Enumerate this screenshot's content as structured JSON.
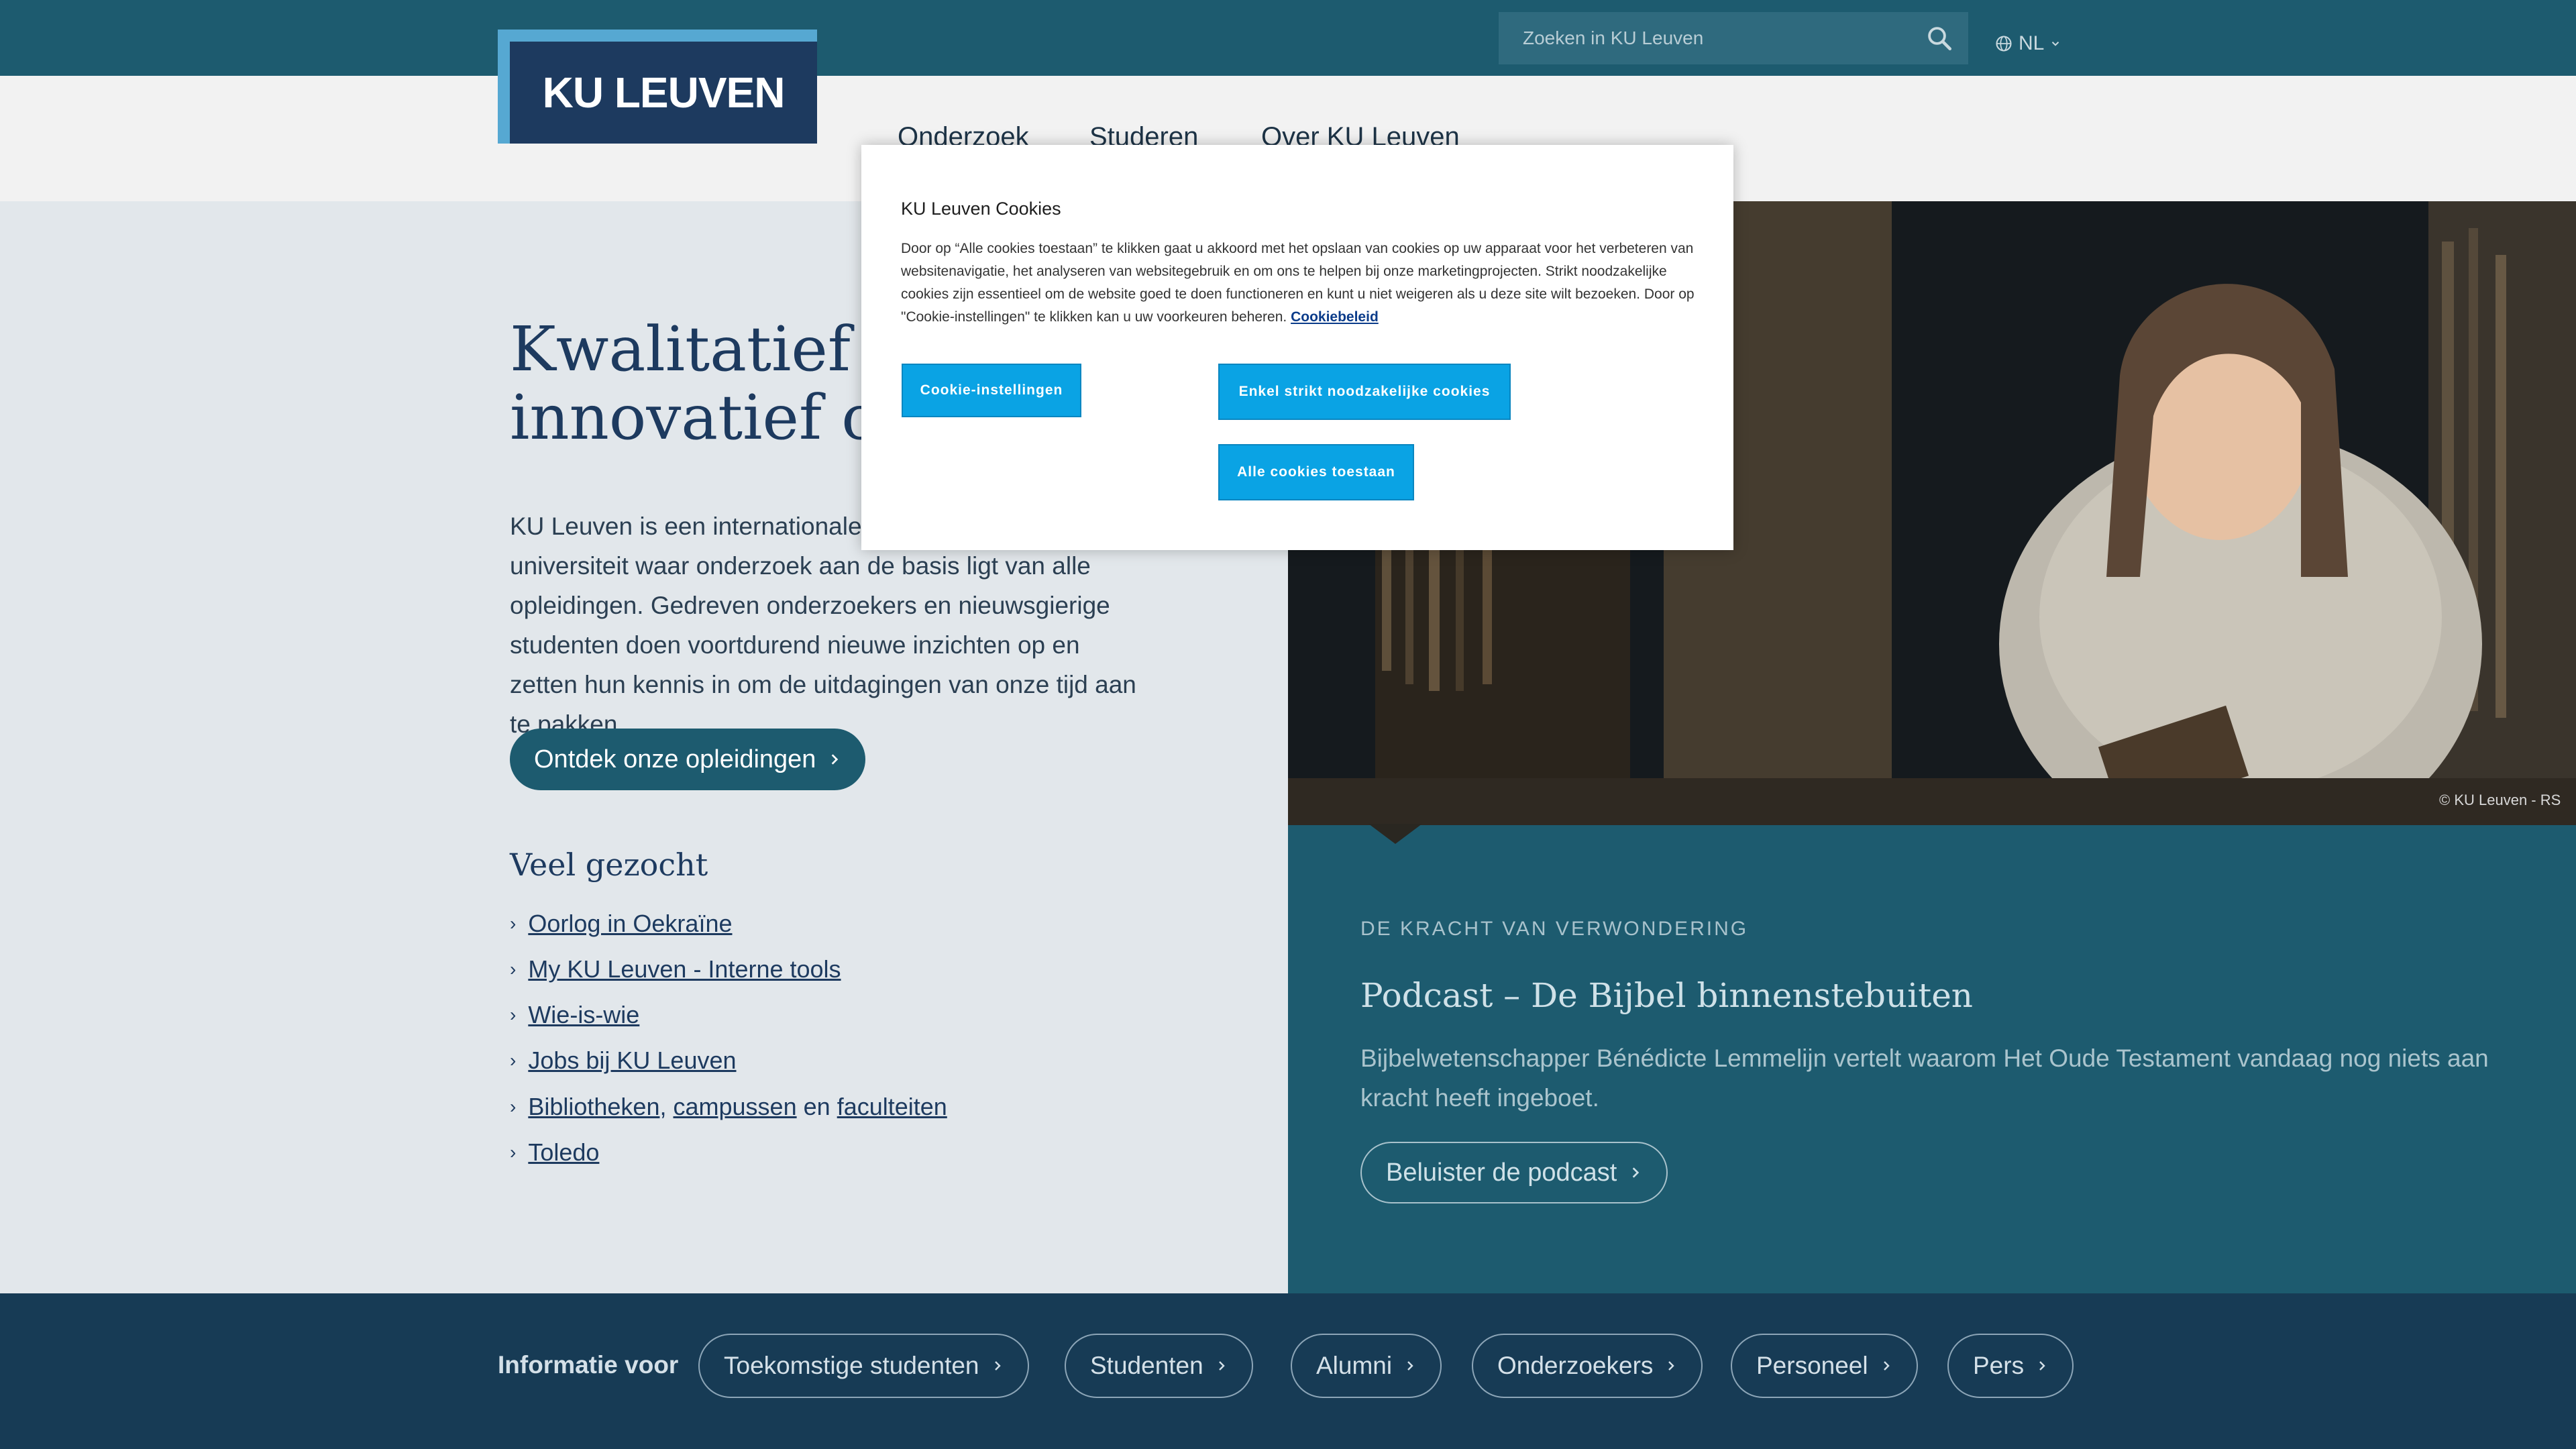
{
  "header": {
    "search_placeholder": "Zoeken in KU Leuven",
    "language": "NL",
    "logo_text": "KU LEUVEN"
  },
  "nav": {
    "items": [
      "Onderzoek",
      "Studeren",
      "Over KU Leuven"
    ]
  },
  "hero": {
    "title_line1": "Kwalitatief onderwijs,",
    "title_line2": "innovatief onderzoek",
    "text": "KU Leuven is een internationale comprehensieve universiteit waar onderzoek aan de basis ligt van alle opleidingen. Gedreven onderzoekers en nieuwsgierige studenten doen voortdurend nieuwe inzichten op en zetten hun kennis in om de uitdagingen van onze tijd aan te pakken.",
    "cta": "Ontdek onze opleidingen"
  },
  "popular": {
    "title": "Veel gezocht",
    "items": [
      {
        "label": "Oorlog in Oekraïne"
      },
      {
        "label": "My KU Leuven - Interne tools"
      },
      {
        "label": "Wie-is-wie"
      },
      {
        "label": "Jobs bij KU Leuven"
      },
      {
        "label_a": "Bibliotheken",
        "sep1": ",",
        "label_b": "campussen",
        "sep2": "en",
        "label_c": "faculteiten"
      },
      {
        "label": "Toledo"
      }
    ]
  },
  "feature": {
    "kicker": "DE KRACHT VAN VERWONDERING",
    "title": "Podcast – De Bijbel binnenstebuiten",
    "text": "Bijbelwetenschapper Bénédicte Lemmelijn vertelt waarom Het Oude Testament vandaag nog niets aan kracht heeft ingeboet.",
    "cta": "Beluister de podcast",
    "photo_credit": "© KU Leuven - RS"
  },
  "infobar": {
    "label": "Informatie voor",
    "pills": [
      "Toekomstige studenten",
      "Studenten",
      "Alumni",
      "Onderzoekers",
      "Personeel",
      "Pers"
    ]
  },
  "cookie_modal": {
    "title": "KU Leuven Cookies",
    "text": "Door op “Alle cookies toestaan” te klikken gaat u akkoord met het opslaan van cookies op uw apparaat voor het verbeteren van websitenavigatie, het analyseren van websitegebruik en om ons te helpen bij onze marketingprojecten. Strikt noodzakelijke cookies zijn essentieel om de website goed te doen functioneren en kunt u niet weigeren als u deze site wilt bezoeken. Door op \"Cookie-instellingen\" te klikken kan u uw voorkeuren beheren.",
    "link": "Cookiebeleid",
    "btn_settings": "Cookie-instellingen",
    "btn_necessary": "Enkel strikt noodzakelijke cookies",
    "btn_all": "Alle cookies toestaan"
  },
  "colors": {
    "topbar": "#1d5b6f",
    "navy": "#1d3a5f",
    "accent_blue": "#0aa3e4",
    "hero_bg": "#e2e7eb",
    "infobar": "#173b55"
  }
}
